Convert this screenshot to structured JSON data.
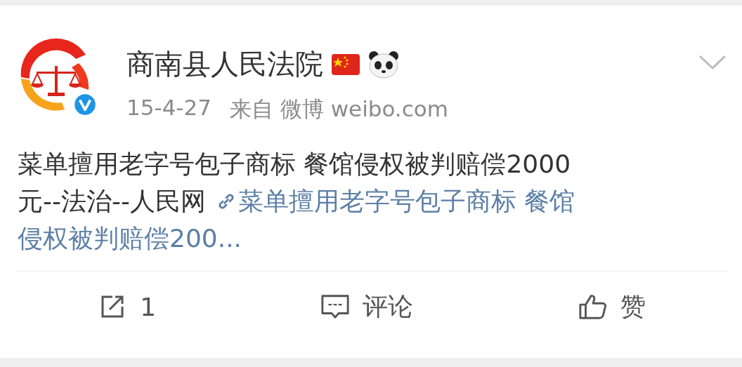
{
  "post": {
    "author": "商南县人民法院",
    "verified": true,
    "date": "15-4-27",
    "source": "来自 微博 weibo.com",
    "text_lines": [
      "菜单擅用老字号包子商标 餐馆侵权被判赔偿2000",
      "元--法治--人民网"
    ],
    "link_lines": [
      "菜单擅用老字号包子商标 餐馆",
      "侵权被判赔偿200..."
    ]
  },
  "actions": [
    {
      "kind": "repost",
      "label": "1"
    },
    {
      "kind": "comment",
      "label": "评论"
    },
    {
      "kind": "like",
      "label": "赞"
    }
  ]
}
